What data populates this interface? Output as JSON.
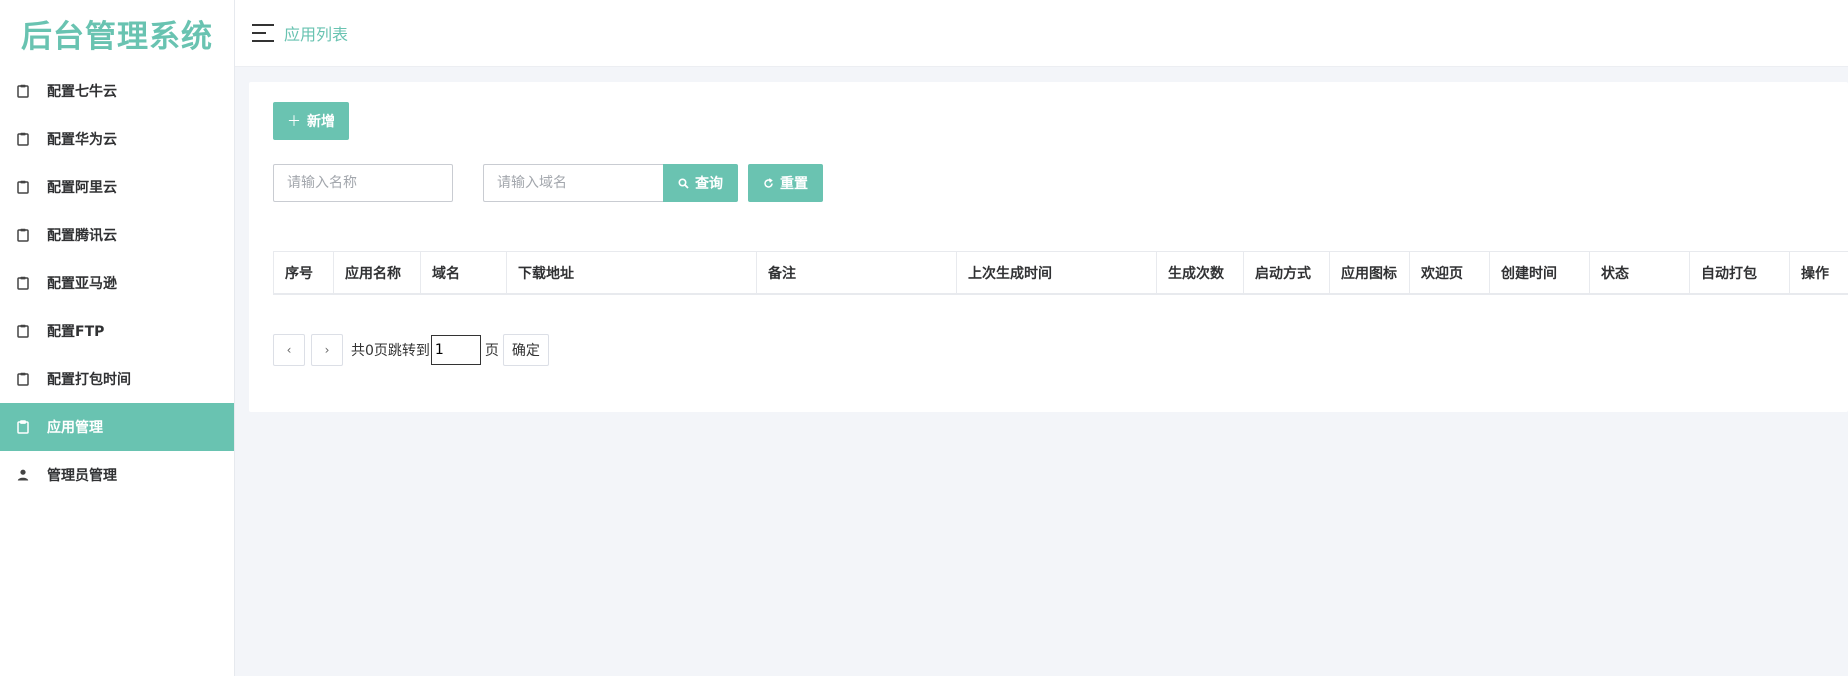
{
  "app": {
    "title": "后台管理系统"
  },
  "sidebar": {
    "items": [
      {
        "label": "配置七牛云",
        "icon": "clipboard-icon"
      },
      {
        "label": "配置华为云",
        "icon": "clipboard-icon"
      },
      {
        "label": "配置阿里云",
        "icon": "clipboard-icon"
      },
      {
        "label": "配置腾讯云",
        "icon": "clipboard-icon"
      },
      {
        "label": "配置亚马逊",
        "icon": "clipboard-icon"
      },
      {
        "label": "配置FTP",
        "icon": "clipboard-icon"
      },
      {
        "label": "配置打包时间",
        "icon": "clipboard-icon"
      },
      {
        "label": "应用管理",
        "icon": "clipboard-icon",
        "active": true
      },
      {
        "label": "管理员管理",
        "icon": "user-icon"
      }
    ]
  },
  "header": {
    "breadcrumb": "应用列表"
  },
  "toolbar": {
    "add_label": "新增",
    "name_placeholder": "请输入名称",
    "domain_placeholder": "请输入域名",
    "search_label": "查询",
    "reset_label": "重置"
  },
  "table": {
    "columns": [
      "序号",
      "应用名称",
      "域名",
      "下载地址",
      "备注",
      "上次生成时间",
      "生成次数",
      "启动方式",
      "应用图标",
      "欢迎页",
      "创建时间",
      "状态",
      "自动打包",
      "操作"
    ]
  },
  "pagination": {
    "prev": "‹",
    "next": "›",
    "summary": "共0页跳转到",
    "page_value": "1",
    "unit": "页",
    "confirm_label": "确定"
  },
  "colors": {
    "accent": "#69c3b1",
    "background": "#f3f5f9"
  }
}
